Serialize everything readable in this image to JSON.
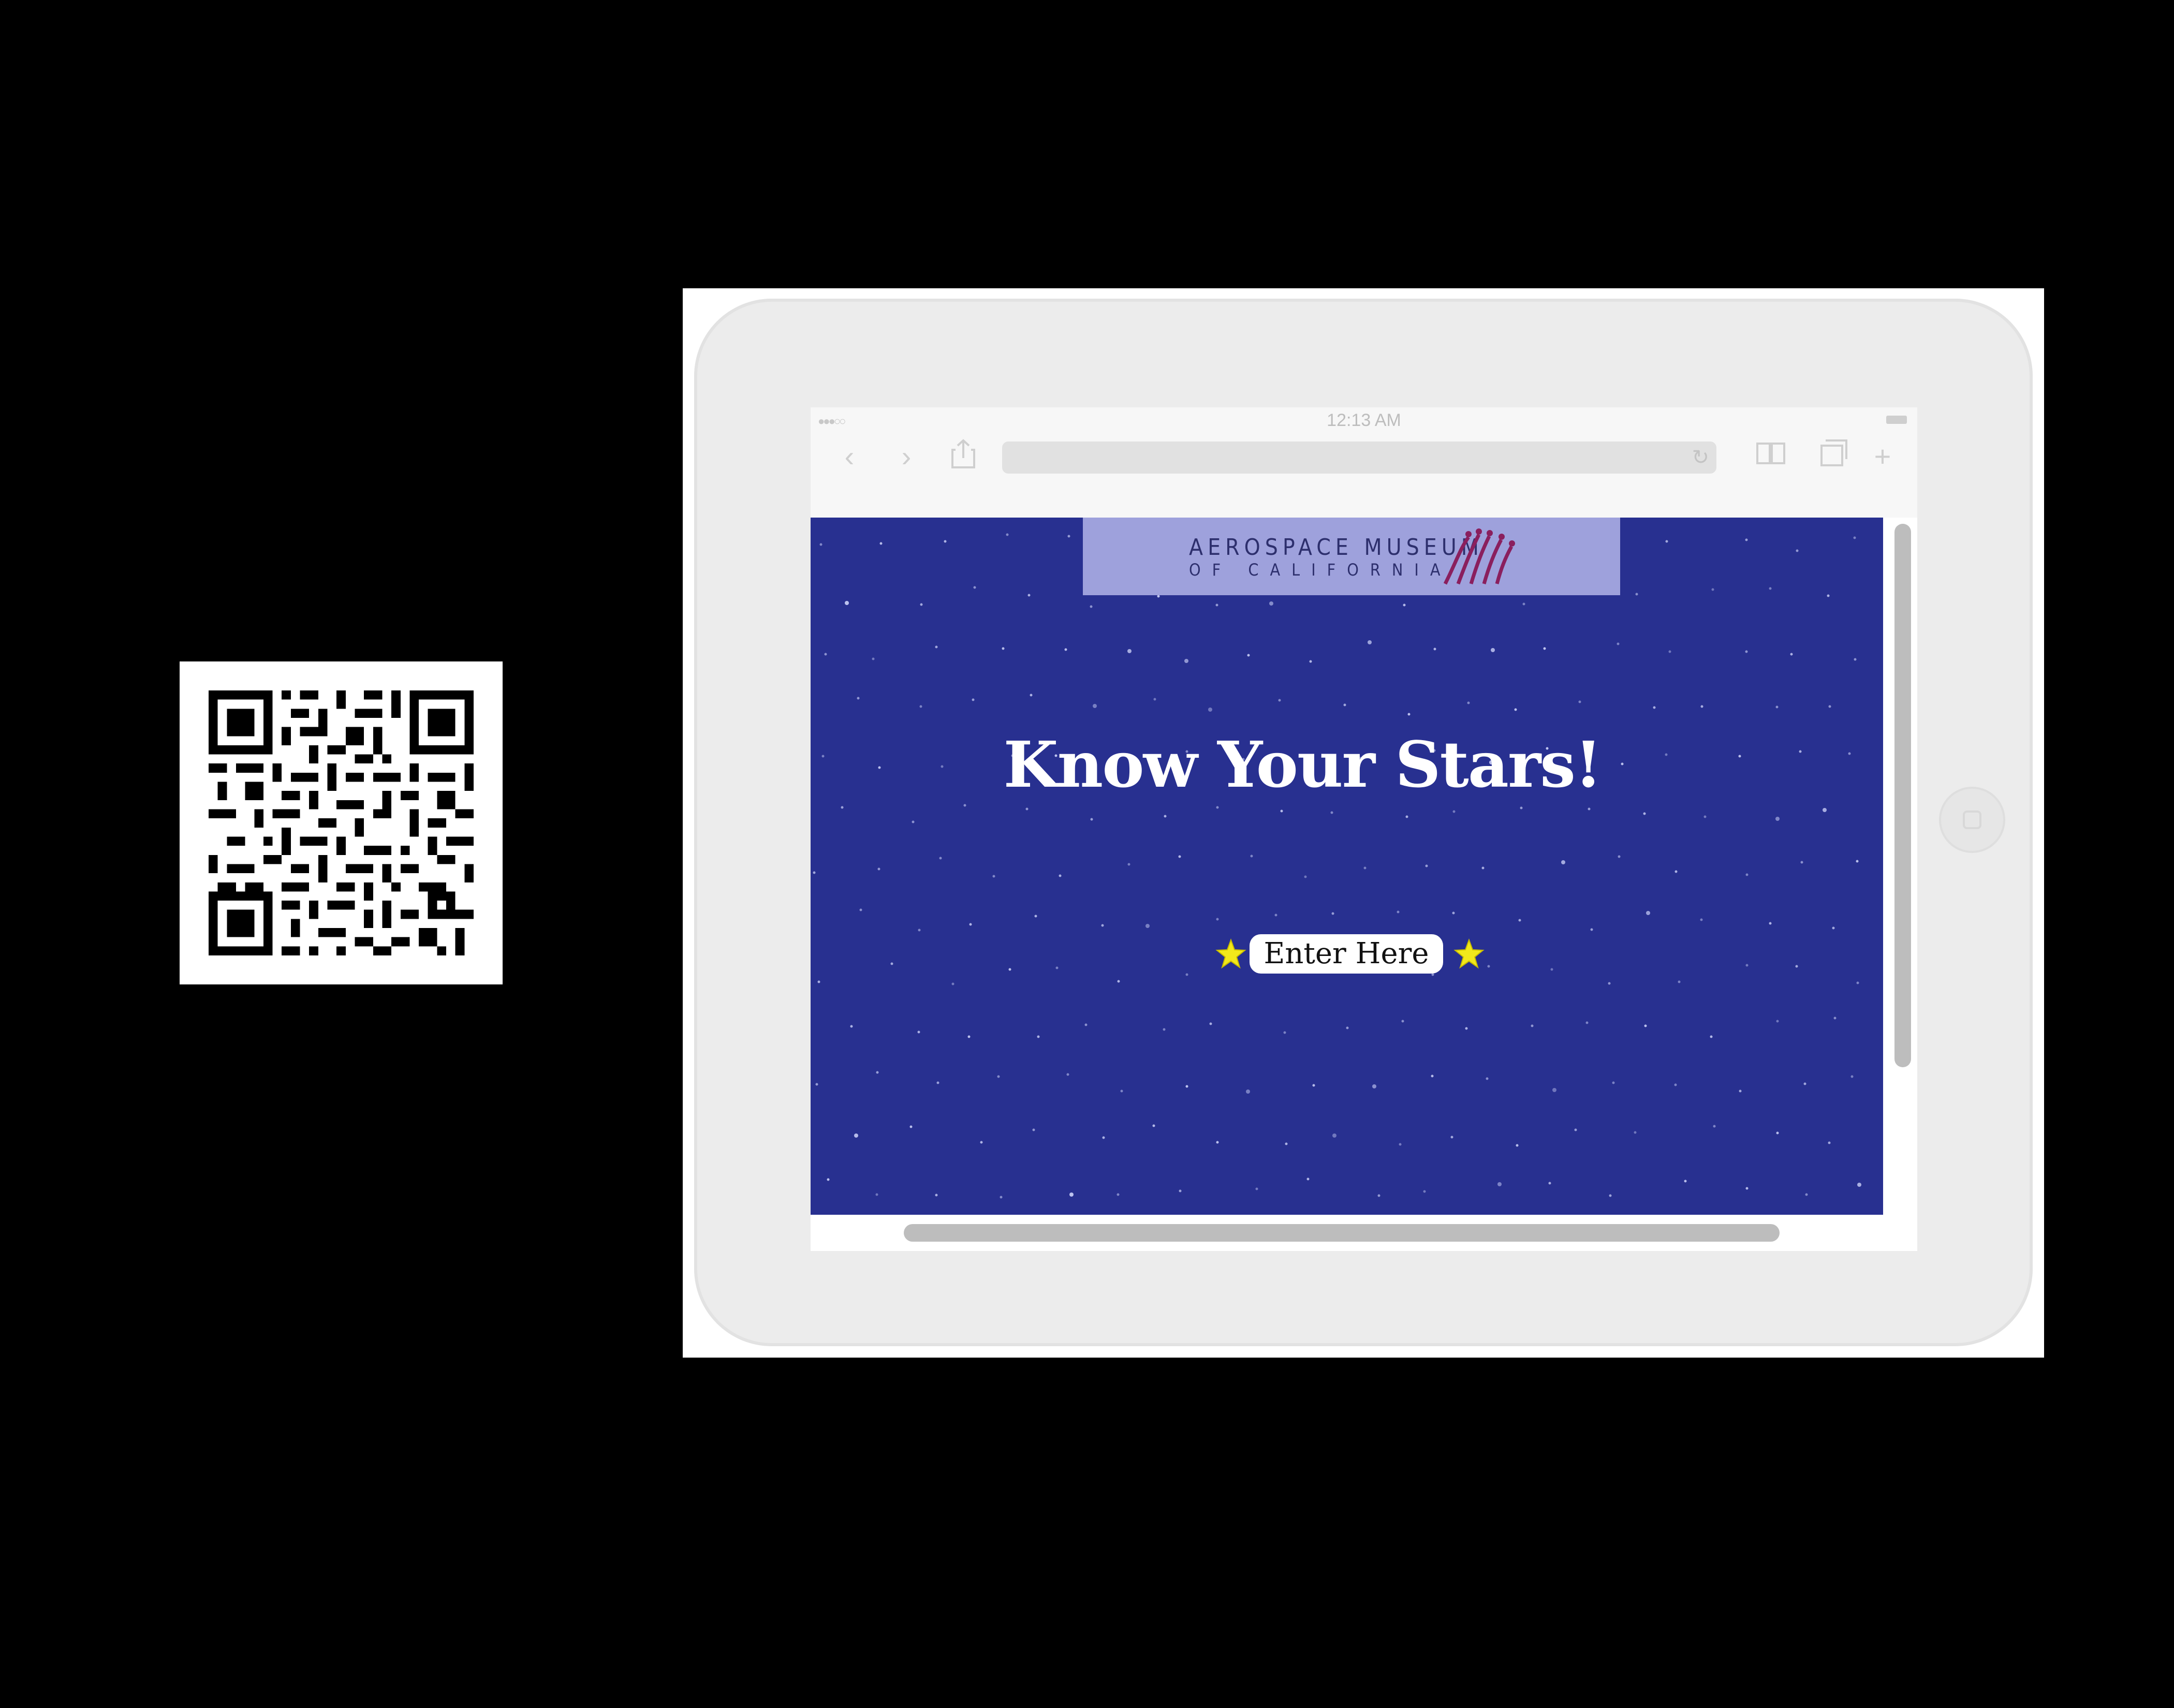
{
  "browser": {
    "status_signal": "●●●○○",
    "time": "12:13 AM",
    "icons": [
      "back-icon",
      "forward-icon",
      "share-icon",
      "reload-icon",
      "reader-icon",
      "tabs-icon",
      "new-tab-icon"
    ]
  },
  "logo": {
    "line1": "AEROSPACE MUSEUM",
    "line2": "OF CALIFORNIA"
  },
  "page": {
    "title": "Know Your Stars!",
    "enter_label": "Enter Here"
  },
  "colors": {
    "page_background": "#283090",
    "logo_banner": "#9ea1dc",
    "star_yellow": "#f2e81b",
    "tablet_body": "#ececec"
  }
}
